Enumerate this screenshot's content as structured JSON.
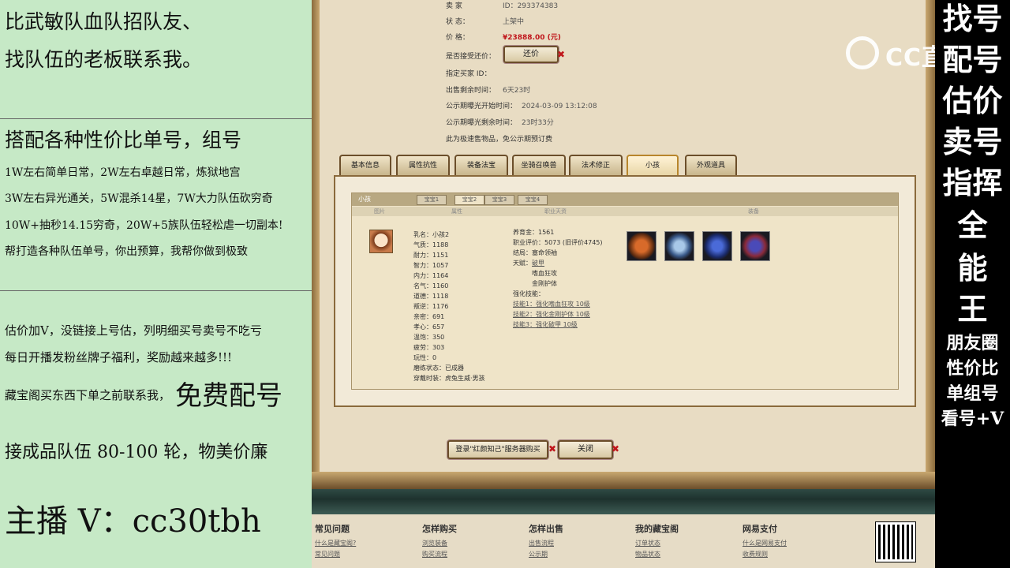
{
  "left_panel": {
    "line1": "比武敏队血队招队友、",
    "line2": "找队伍的老板联系我。",
    "line3": "搭配各种性价比单号，组号",
    "line4": "1W左右简单日常，2W左右卓越日常，炼狱地宫",
    "line5": "3W左右异光通关，5W混杀14星，7W大力队伍砍穷奇",
    "line6": "10W+抽秒14.15穷奇，20W+5族队伍轻松虐一切副本!",
    "line7": "帮打造各种队伍单号，你出预算，我帮你做到极致",
    "line8": "估价加V，没链接上号估，列明细买号卖号不吃亏",
    "line9": "每日开播发粉丝牌子福利，奖励越来越多!!!",
    "line10a": "藏宝阁买东西下单之前联系我，",
    "line10b": "免费配号",
    "line11": "接成品队伍 80-100 轮，物美价廉",
    "line12": "主播 V：cc30tbh"
  },
  "info": {
    "seller_label": "卖    家",
    "seller_value": "ID：293374383",
    "status_label": "状    态：",
    "status_value": "上架中",
    "price_label": "价    格：",
    "price_value": "¥23888.00 (元)",
    "bargain_label": "是否接受还价：",
    "bargain_button": "还价",
    "buyer_label": "指定买家 ID：",
    "remain_label": "出售剩余时间：",
    "remain_value": "6天23时",
    "public_start_label": "公示期曝光开始时间：",
    "public_start_value": "2024-03-09 13:12:08",
    "public_remain_label": "公示期曝光剩余时间：",
    "public_remain_value": "23时33分",
    "note": "此为极速售物品，免公示期预订费"
  },
  "tabs": [
    "基本信息",
    "属性抗性",
    "装备法宝",
    "坐骑召唤兽",
    "法术修正",
    "小孩",
    "外观道具"
  ],
  "child_panel": {
    "title": "小孩",
    "subtabs": [
      "宝宝1",
      "宝宝2",
      "宝宝3",
      "宝宝4"
    ],
    "headers": [
      "图片",
      "属性",
      "职业天资",
      "装备"
    ],
    "attrs": [
      "乳名：小孩2",
      "气质：1188",
      "耐力：1151",
      "智力：1057",
      "内力：1164",
      "名气：1160",
      "道德：1118",
      "叛逆：1176",
      "亲密：691",
      "孝心：657",
      "温饱：350",
      "疲劳：303",
      "玩性：0",
      "磨练状态：已成器",
      "穿戴时装：虎兔生威·男孩"
    ],
    "career": {
      "raise": "养育金：1561",
      "eval": "职业评价：5073 (旧评价4745)",
      "ending": "结局：塞命领袖",
      "talent_label": "天赋：",
      "talents": [
        "破甲",
        "嗜血狂攻",
        "金刚护体"
      ],
      "skill_label": "强化技能：",
      "skills": [
        "技能1：强化嗜血狂攻 10级",
        "技能2：强化金刚护体 10级",
        "技能3：强化破甲 10级"
      ]
    }
  },
  "buttons": {
    "login": "登录\"红颜知己\"服务器购买",
    "close": "关闭"
  },
  "footer": {
    "cols": [
      {
        "h": "常见问题",
        "links": [
          "什么是藏宝阁?",
          "常见问题"
        ]
      },
      {
        "h": "怎样购买",
        "links": [
          "浏览装备",
          "购买流程"
        ]
      },
      {
        "h": "怎样出售",
        "links": [
          "出售流程",
          "公示期"
        ]
      },
      {
        "h": "我的藏宝阁",
        "links": [
          "订单状态",
          "物品状态"
        ]
      },
      {
        "h": "网易支付",
        "links": [
          "什么是网易支付",
          "收费规则"
        ]
      }
    ]
  },
  "logo": {
    "text": "CC直播"
  },
  "right_panel": {
    "big": [
      "找号",
      "配号",
      "估价",
      "卖号",
      "指挥",
      "全",
      "能",
      "王"
    ],
    "small": [
      "朋友圈",
      "性价比",
      "单组号",
      "看号+V"
    ]
  },
  "colors": {
    "left_bg": "#c6e9c6",
    "price_red": "#c0161b",
    "frame_brown": "#8a6a3c"
  }
}
